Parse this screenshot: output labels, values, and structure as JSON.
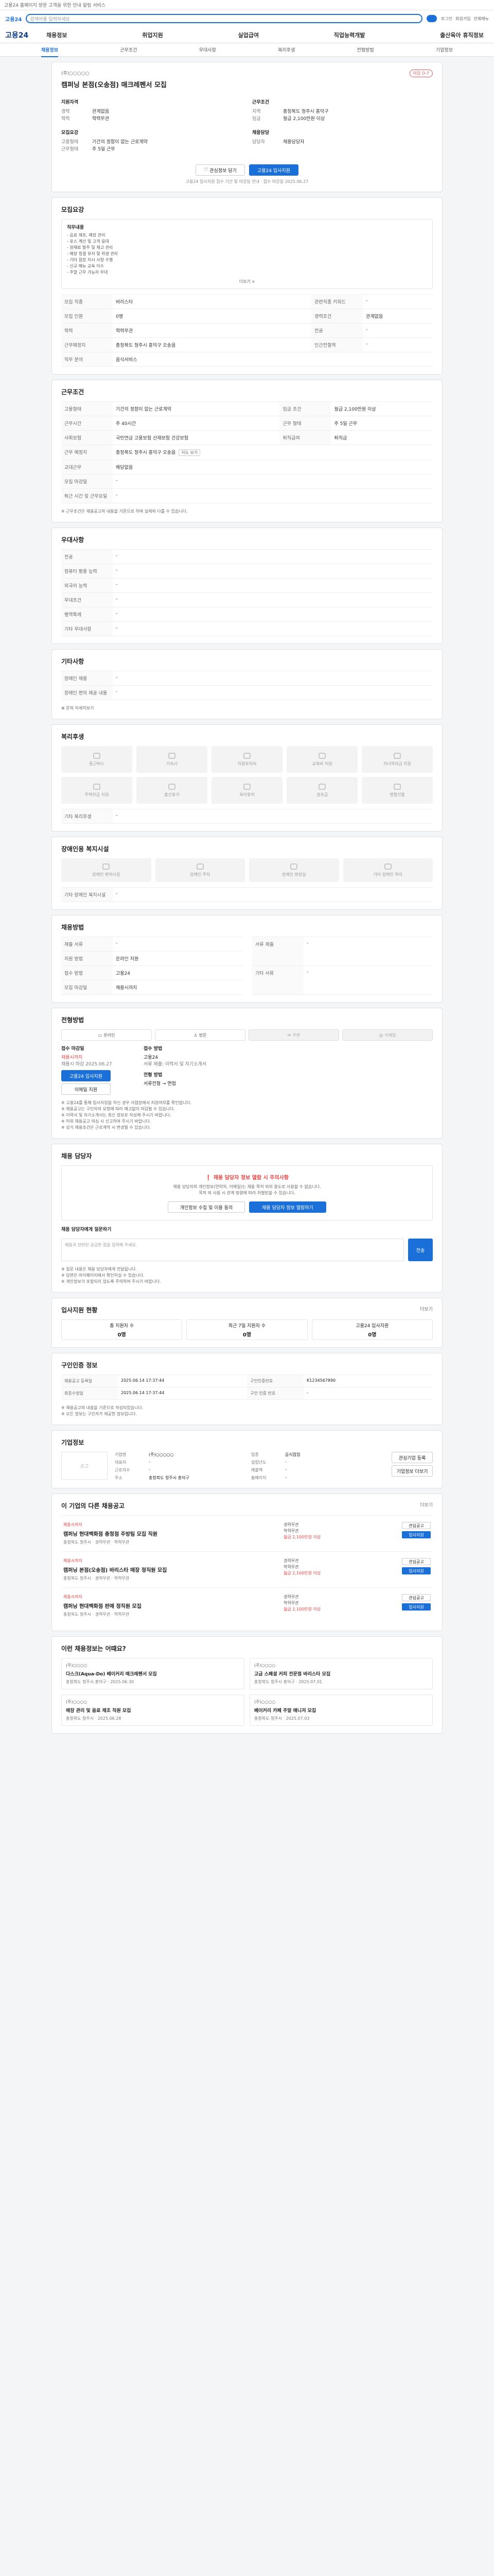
{
  "top": {
    "notice": "고용24 홈페이지 방문 고객을 위한 안내 알림 서비스",
    "login": "로그인",
    "join": "회원가입"
  },
  "search": {
    "logo": "고용24",
    "placeholder": "검색어를 입력하세요",
    "util": [
      "로그인",
      "회원가입",
      "전체메뉴"
    ]
  },
  "gnb": {
    "brand": "고용24",
    "menu": [
      "채용정보",
      "취업지원",
      "실업급여",
      "직업능력개발",
      "출산육아 휴직정보"
    ]
  },
  "tabs": {
    "items": [
      "채용정보",
      "근무조건",
      "우대사항",
      "복리후생",
      "전형방법",
      "기업정보"
    ],
    "active": 0
  },
  "job": {
    "company": "(주)○○○○○",
    "title": "캠퍼닝 본점(오송점) 매크레펜서 모집",
    "dday": "마감 D-7",
    "left_h": "지원자격",
    "left": [
      [
        "경력",
        "관계없음"
      ],
      [
        "학력",
        "학력무관"
      ]
    ],
    "right_h": "근무조건",
    "right": [
      [
        "지역",
        "충청북도 청주시 흥덕구"
      ],
      [
        "임금",
        "월급 2,100만원 이상"
      ]
    ],
    "left2_h": "모집요강",
    "left2": [
      [
        "고용형태",
        "기간의 정함이 없는 근로계약"
      ],
      [
        "근무형태",
        "주 5일 근무"
      ]
    ],
    "right2_h": "채용담당",
    "right2": [
      [
        "담당자",
        "채용담당자"
      ]
    ],
    "like": "관심정보 담기",
    "apply": "고용24 입사지원",
    "note": "고용24 입사지원 접수 기간 및 마감일 안내 · 접수 마감일 2025.06.27"
  },
  "recruit": {
    "title": "모집요강",
    "duties_h": "직무내용",
    "duties": [
      "- 음료 제조, 매장 관리",
      "- 포스 계산 및 고객 응대",
      "- 원재료 발주 및 재고 관리",
      "- 매장 청결 유지 및 위생 관리",
      "- 기타 점장 지시 사항 수행",
      "- 신규 메뉴 교육 이수",
      "- 주말 근무 가능자 우대"
    ],
    "more": "더보기 ∨",
    "rows": [
      [
        "모집 직종",
        "바리스타",
        "관련직종 키워드",
        "-"
      ],
      [
        "모집 인원",
        "0명",
        "경력조건",
        "관계없음"
      ],
      [
        "학력",
        "학력무관",
        "전공",
        "-"
      ]
    ],
    "location_k": "근무예정지",
    "location_v": "충청북도 청주시 흥덕구 오송읍",
    "location_k2": "인근전철역",
    "location_v2": "-",
    "type_k": "직무 분야",
    "type_v": "음식서비스"
  },
  "conditions": {
    "title": "근무조건",
    "rows": [
      [
        "고용형태",
        "기간의 정함이 없는 근로계약",
        "임금 조건",
        "월급 2,100만원 이상"
      ],
      [
        "근무시간",
        "주 40시간",
        "근무 형태",
        "주 5일 근무"
      ],
      [
        "사회보험",
        "국민연금 고용보험 산재보험 건강보험",
        "퇴직급여",
        "퇴직금"
      ],
      [
        "근무 예정지",
        "충청북도 청주시 흥덕구 오송읍",
        "",
        ""
      ]
    ],
    "map_btn": "지도 보기",
    "extra": [
      [
        "교대근무",
        "해당없음"
      ],
      [
        "모집 마감일",
        "-"
      ],
      [
        "퇴근 시간 및 근무요일",
        "-"
      ]
    ],
    "footnote": "※ 근무조건은 채용공고의 내용을 기준으로 하며 실제와 다를 수 있습니다."
  },
  "prefer": {
    "title": "우대사항",
    "rows": [
      [
        "전공",
        "-"
      ],
      [
        "컴퓨터 활용 능력",
        "-"
      ],
      [
        "외국어 능력",
        "-"
      ],
      [
        "우대조건",
        "-"
      ],
      [
        "병역특례",
        "-"
      ],
      [
        "기타 우대사항",
        "-"
      ]
    ]
  },
  "extra_info": {
    "title": "기타사항",
    "rows": [
      [
        "장애인 채용",
        "-"
      ],
      [
        "장애인 편의 제공 내용",
        "-"
      ]
    ],
    "more_btn": "⊕ 문의 자세히보기"
  },
  "welfare": {
    "title": "복리후생",
    "items": [
      "통근버스",
      "기숙사",
      "차량유지비",
      "교육비 지원",
      "자녀학자금 지원",
      "주택자금 지원",
      "출산휴가",
      "육아휴직",
      "경조금",
      "명절선물"
    ],
    "etc_k": "기타 복리후생",
    "etc_v": "-"
  },
  "disabled_welfare": {
    "title": "장애인용 복지시설",
    "items": [
      "장애인 편의시설",
      "장애인 주차",
      "장애인 화장실",
      "기타 장애인 복지"
    ],
    "etc_k": "기타 장애인 복지시설",
    "etc_v": "-"
  },
  "process": {
    "title": "채용방법",
    "rows": [
      [
        "제출 서류",
        "-"
      ],
      [
        "지원 방법",
        "온라인 지원"
      ],
      [
        "접수 방법",
        "고용24"
      ],
      [
        "모집 마감일",
        "채용시까지"
      ]
    ],
    "rows_r": [
      [
        "서류 제출",
        "-"
      ],
      [
        "기타 서류",
        "-"
      ]
    ]
  },
  "apply": {
    "title": "전형방법",
    "methods": [
      "온라인",
      "방문",
      "우편",
      "이메일"
    ],
    "methods_off": [
      false,
      false,
      true,
      true
    ],
    "proc_h1": "접수 마감일",
    "proc_v1": "채용시까지",
    "proc_v1b": "채용시 마감 2025.06.27",
    "apply_btn": "고용24 입사지원",
    "email_btn": "이메일 지원",
    "proc_h2": "접수 방법",
    "proc_v2": "고용24",
    "proc_v2b": "서류 제출: 이력서 및 자기소개서",
    "proc_h3": "전형 방법",
    "proc_v3": "서류전형 → 면접",
    "notes": [
      "※ 고용24를 통해 입사지원을 하신 경우 사업장에서 지원여부를 확인합니다.",
      "※ 채용공고는 구인자의 요청에 따라 예고없이 마감될 수 있습니다.",
      "※ 이력서 및 자기소개서는 최신 정보로 작성해 주시기 바랍니다.",
      "※ 허위 채용공고 의심 시 신고하여 주시기 바랍니다.",
      "※ 상기 채용조건은 근로계약 시 변경될 수 있습니다."
    ]
  },
  "contact": {
    "title": "채용 담당자",
    "warn": "❗ 채용 담당자 정보 열람 시 주의사항",
    "desc": [
      "채용 담당자의 개인정보(연락처, 이메일)는 채용 목적 외의 용도로 사용할 수 없습니다.",
      "목적 외 사용 시 관계 법령에 따라 처벌받을 수 있습니다."
    ],
    "btn1": "개인정보 수집 및 이용 동의",
    "btn2": "채용 담당자 정보 열람하기",
    "inq_h": "채용 담당자에게 질문하기",
    "inq_placeholder": "채용과 관련된 궁금한 점을 입력해 주세요.",
    "send": "전송",
    "notes": [
      "※ 질문 내용은 채용 담당자에게 전달됩니다.",
      "※ 답변은 마이페이지에서 확인하실 수 있습니다.",
      "※ 개인정보가 포함되지 않도록 주의하여 주시기 바랍니다."
    ]
  },
  "status": {
    "title": "입사지원 현황",
    "more": "더보기",
    "items": [
      [
        "총 지원자 수",
        "0명"
      ],
      [
        "최근 7일 지원자 수",
        "0명"
      ],
      [
        "고용24 입사지원",
        "0명"
      ]
    ]
  },
  "info": {
    "title": "구인인증 정보",
    "rows": [
      [
        "채용공고 등록일",
        "2025.06.14 17:37:44",
        "구인인증번호",
        "K1234567890"
      ],
      [
        "최종수정일",
        "2025.06.14 17:37:44",
        "구인 인증 번호",
        "-"
      ]
    ],
    "notes": [
      "※ 채용공고의 내용을 기준으로 작성되었습니다.",
      "※ 모든 정보는 구인자가 제공한 정보입니다."
    ]
  },
  "corp": {
    "title": "기업정보",
    "logo": "로고",
    "fields": [
      [
        "기업명",
        "(주)○○○○○"
      ],
      [
        "업종",
        "음식점업"
      ],
      [
        "대표자",
        "-"
      ],
      [
        "설립년도",
        "-"
      ],
      [
        "근로자수",
        "-"
      ],
      [
        "매출액",
        "-"
      ],
      [
        "주소",
        "충청북도 청주시 흥덕구"
      ],
      [
        "홈페이지",
        "-"
      ]
    ],
    "btn1": "관심기업 등록",
    "btn2": "기업정보 더보기"
  },
  "others": {
    "title": "이 기업의 다른 채용공고",
    "more": "더보기",
    "items": [
      {
        "tag": "채용시까지",
        "title": "캠퍼닝 현대백화점 충청점 주방팀 모집 직원",
        "meta": "충청북도 청주시 · 경력무관 · 학력무관",
        "right": [
          "경력무관",
          "학력무관",
          "월급 2,100만원 이상"
        ]
      },
      {
        "tag": "채용시까지",
        "title": "캠퍼닝 본점(오송점) 바리스타 매장 정직원 모집",
        "meta": "충청북도 청주시 · 경력무관 · 학력무관",
        "right": [
          "경력무관",
          "학력무관",
          "월급 2,100만원 이상"
        ]
      },
      {
        "tag": "채용시까지",
        "title": "캠퍼닝 현대백화점 판매 정직원 모집",
        "meta": "충청북도 청주시 · 경력무관 · 학력무관",
        "right": [
          "경력무관",
          "학력무관",
          "월급 2,100만원 이상"
        ]
      }
    ],
    "btn_like": "관심공고",
    "btn_apply": "입사지원"
  },
  "recommend": {
    "title": "이런 채용정보는 어때요?",
    "items": [
      {
        "co": "(주)○○○○",
        "title": "다스크(Aqua-Do) 베이커리 매크레펜서 모집",
        "meta": "충청북도 청주시 흥덕구 · 2025.06.30"
      },
      {
        "co": "(주)○○○○",
        "title": "고급 스페셜 커피 전문점 바리스타 모집",
        "meta": "충청북도 청주시 흥덕구 · 2025.07.01"
      },
      {
        "co": "(주)○○○○",
        "title": "매장 관리 및 음료 제조 직원 모집",
        "meta": "충청북도 청주시 · 2025.06.28"
      },
      {
        "co": "(주)○○○○",
        "title": "베이커리 카페 주말 매니저 모집",
        "meta": "충청북도 청주시 · 2025.07.03"
      }
    ]
  }
}
